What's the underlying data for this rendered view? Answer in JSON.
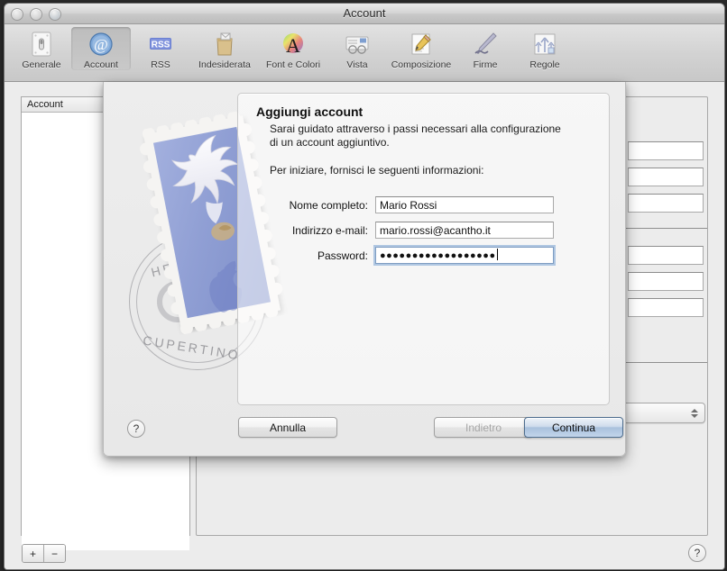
{
  "window": {
    "title": "Account",
    "traffic_lights": [
      "close",
      "minimize",
      "zoom"
    ]
  },
  "toolbar": {
    "items": [
      {
        "label": "Generale",
        "icon": "general-switch-icon",
        "selected": false
      },
      {
        "label": "Account",
        "icon": "at-sign-icon",
        "selected": true
      },
      {
        "label": "RSS",
        "icon": "rss-icon",
        "selected": false
      },
      {
        "label": "Indesiderata",
        "icon": "junk-bag-icon",
        "selected": false
      },
      {
        "label": "Font e Colori",
        "icon": "font-color-icon",
        "selected": false
      },
      {
        "label": "Vista",
        "icon": "viewing-glasses-icon",
        "selected": false
      },
      {
        "label": "Composizione",
        "icon": "compose-pencil-icon",
        "selected": false
      },
      {
        "label": "Firme",
        "icon": "signature-pen-icon",
        "selected": false
      },
      {
        "label": "Regole",
        "icon": "rules-arrows-icon",
        "selected": false
      }
    ]
  },
  "sidebar": {
    "header": "Account",
    "items": [],
    "add_label": "+",
    "remove_label": "−"
  },
  "window_help": {
    "label": "?"
  },
  "sheet": {
    "title": "Aggiungi account",
    "paragraph": "Sarai guidato attraverso i passi necessari alla configurazione di un account aggiuntivo.",
    "paragraph2": "Per iniziare, fornisci le seguenti informazioni:",
    "help_label": "?",
    "stamp": {
      "postmark_top": "HELLO FROM",
      "postmark_bottom": "CUPERTINO"
    },
    "fields": [
      {
        "label": "Nome completo:",
        "value": "Mario Rossi",
        "placeholder": "",
        "type": "text",
        "focused": false,
        "name": "full-name-field"
      },
      {
        "label": "Indirizzo e-mail:",
        "value": "mario.rossi@acantho.it",
        "placeholder": "",
        "type": "text",
        "focused": false,
        "name": "email-address-field"
      },
      {
        "label": "Password:",
        "value": "●●●●●●●●●●●●●●●●●●",
        "placeholder": "",
        "type": "password",
        "focused": true,
        "name": "password-field"
      }
    ],
    "buttons": {
      "cancel": "Annulla",
      "back": "Indietro",
      "continue": "Continua"
    }
  },
  "colors": {
    "accent": "#a9c1dd",
    "focus_ring": "#76a0d2",
    "stamp_blue": "#8e9ed2",
    "window_bg": "#ececec"
  }
}
